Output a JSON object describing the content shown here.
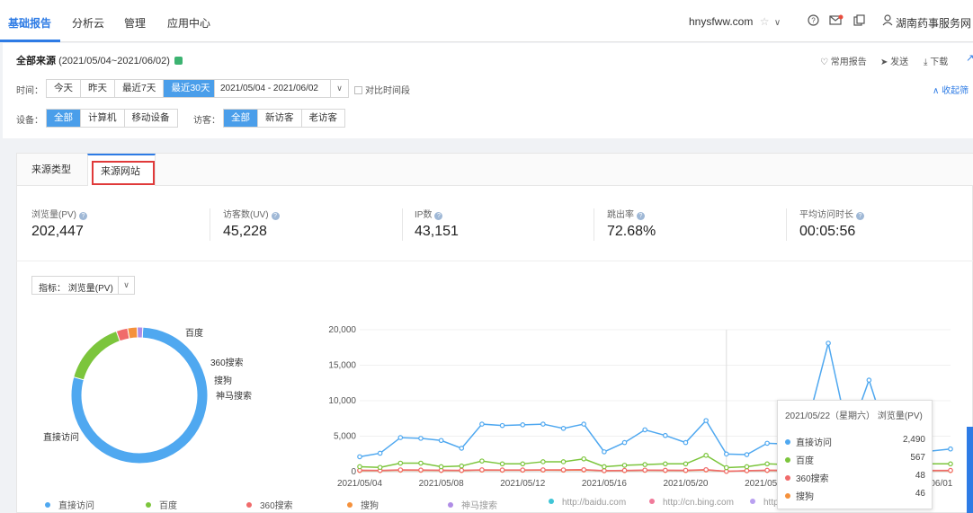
{
  "nav": {
    "items": [
      "基础报告",
      "分析云",
      "管理",
      "应用中心"
    ],
    "site": "hnysfww.com",
    "account": "湖南药事服务网"
  },
  "header": {
    "title": "全部来源",
    "range": "(2021/05/04~2021/06/02)",
    "actions": {
      "common": "常用报告",
      "send": "发送",
      "download": "下载"
    },
    "collapse": "收起筛",
    "time_label": "时间：",
    "time_buttons": [
      "今天",
      "昨天",
      "最近7天",
      "最近30天"
    ],
    "date_range": "2021/05/04 - 2021/06/02",
    "compare": "对比时间段",
    "device_label": "设备：",
    "device_buttons": [
      "全部",
      "计算机",
      "移动设备"
    ],
    "visitor_label": "访客：",
    "visitor_buttons": [
      "全部",
      "新访客",
      "老访客"
    ]
  },
  "tabs": [
    "来源类型",
    "来源网站"
  ],
  "metrics": [
    {
      "label": "浏览量(PV)",
      "value": "202,447"
    },
    {
      "label": "访客数(UV)",
      "value": "45,228"
    },
    {
      "label": "IP数",
      "value": "43,151"
    },
    {
      "label": "跳出率",
      "value": "72.68%"
    },
    {
      "label": "平均访问时长",
      "value": "00:05:56"
    }
  ],
  "indicator": {
    "label": "指标：",
    "value": "浏览量(PV)"
  },
  "colors": {
    "accent": "#2d7be5",
    "direct": "#4fa8f0",
    "baidu": "#7cc53c",
    "s360": "#f06b6b",
    "sogou": "#f5913c",
    "shenma": "#b08de6",
    "baidu_com": "#3fc5d6",
    "bing": "#f07a9a",
    "other": "#b9a0f0"
  },
  "chart_data": [
    {
      "type": "pie",
      "labels": [
        "直接访问",
        "百度",
        "360搜索",
        "搜狗",
        "神马搜索"
      ],
      "values": [
        150000,
        29000,
        5200,
        4300,
        2500
      ]
    },
    {
      "type": "line",
      "x": [
        "2021/05/04",
        "2021/05/05",
        "2021/05/06",
        "2021/05/07",
        "2021/05/08",
        "2021/05/09",
        "2021/05/10",
        "2021/05/11",
        "2021/05/12",
        "2021/05/13",
        "2021/05/14",
        "2021/05/15",
        "2021/05/16",
        "2021/05/17",
        "2021/05/18",
        "2021/05/19",
        "2021/05/20",
        "2021/05/21",
        "2021/05/22",
        "2021/05/23",
        "2021/05/24",
        "2021/05/25",
        "2021/05/26",
        "2021/05/27",
        "2021/05/28",
        "2021/05/29",
        "2021/05/30",
        "2021/05/31",
        "2021/06/01",
        "2021/06/02"
      ],
      "x_ticks": [
        "2021/05/04",
        "2021/05/08",
        "2021/05/12",
        "2021/05/16",
        "2021/05/20",
        "2021/05/24",
        "2021/05/28",
        "2021/06/01"
      ],
      "ylim": [
        0,
        20000
      ],
      "y_ticks": [
        "0",
        "5,000",
        "10,000",
        "15,000",
        "20,000"
      ],
      "series": [
        {
          "name": "直接访问",
          "values": [
            2100,
            2600,
            4800,
            4700,
            4400,
            3300,
            6700,
            6500,
            6600,
            6700,
            6100,
            6700,
            2800,
            4100,
            5900,
            5100,
            4100,
            7200,
            2490,
            2400,
            4000,
            3900,
            7000,
            18100,
            4900,
            12900,
            4000,
            3600,
            2900,
            3200
          ]
        },
        {
          "name": "百度",
          "values": [
            700,
            600,
            1200,
            1200,
            700,
            800,
            1500,
            1100,
            1100,
            1400,
            1400,
            1800,
            700,
            900,
            1000,
            1100,
            1100,
            2300,
            567,
            700,
            1100,
            1000,
            1400,
            1200,
            1000,
            1200,
            1000,
            1000,
            1100,
            1100
          ]
        },
        {
          "name": "360搜索",
          "values": [
            200,
            180,
            250,
            230,
            200,
            190,
            260,
            240,
            240,
            260,
            250,
            280,
            150,
            180,
            220,
            200,
            190,
            280,
            48,
            150,
            200,
            190,
            230,
            260,
            200,
            240,
            190,
            180,
            170,
            180
          ]
        },
        {
          "name": "搜狗",
          "values": [
            160,
            150,
            200,
            190,
            170,
            160,
            220,
            200,
            210,
            220,
            210,
            230,
            130,
            150,
            190,
            170,
            160,
            240,
            46,
            130,
            170,
            160,
            200,
            220,
            170,
            200,
            160,
            150,
            140,
            150
          ]
        }
      ]
    }
  ],
  "legend": [
    "直接访问",
    "百度",
    "360搜索",
    "搜狗",
    "神马搜索",
    "http://baidu.com",
    "http://cn.bing.com",
    "http"
  ],
  "tooltip": {
    "title": "2021/05/22（星期六） 浏览量(PV)",
    "rows": [
      {
        "name": "直接访问",
        "value": "2,490"
      },
      {
        "name": "百度",
        "value": "567"
      },
      {
        "name": "360搜索",
        "value": "48"
      },
      {
        "name": "搜狗",
        "value": "46"
      }
    ]
  }
}
